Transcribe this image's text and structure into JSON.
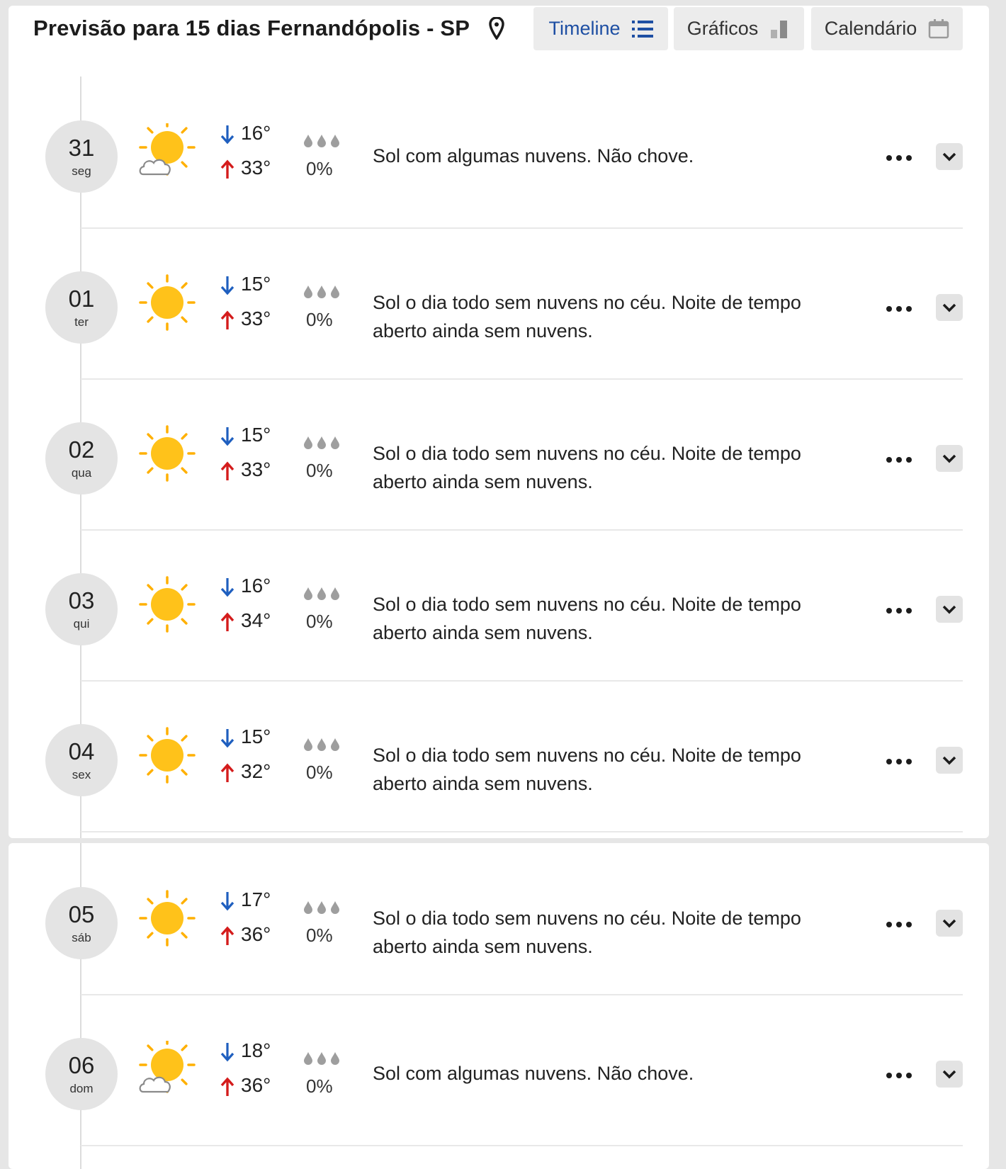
{
  "header": {
    "title": "Previsão para 15 dias Fernandópolis - SP",
    "tabs": [
      {
        "label": "Timeline",
        "icon": "list-icon",
        "active": true
      },
      {
        "label": "Gráficos",
        "icon": "bar-chart-icon",
        "active": false
      },
      {
        "label": "Calendário",
        "icon": "calendar-icon",
        "active": false
      }
    ]
  },
  "colors": {
    "accent": "#1e4fa3",
    "min_arrow": "#1f5fbf",
    "max_arrow": "#d41c1c",
    "sun": "#ffc21a",
    "circle_bg": "#e4e4e4"
  },
  "days": [
    {
      "day": "31",
      "weekday": "seg",
      "icon": "sun-cloud-icon",
      "min": "16°",
      "max": "33°",
      "rain": "0%",
      "description": "Sol com algumas nuvens. Não chove."
    },
    {
      "day": "01",
      "weekday": "ter",
      "icon": "sun-icon",
      "min": "15°",
      "max": "33°",
      "rain": "0%",
      "description": "Sol o dia todo sem nuvens no céu. Noite de tempo aberto ainda sem nuvens."
    },
    {
      "day": "02",
      "weekday": "qua",
      "icon": "sun-icon",
      "min": "15°",
      "max": "33°",
      "rain": "0%",
      "description": "Sol o dia todo sem nuvens no céu. Noite de tempo aberto ainda sem nuvens."
    },
    {
      "day": "03",
      "weekday": "qui",
      "icon": "sun-icon",
      "min": "16°",
      "max": "34°",
      "rain": "0%",
      "description": "Sol o dia todo sem nuvens no céu. Noite de tempo aberto ainda sem nuvens."
    },
    {
      "day": "04",
      "weekday": "sex",
      "icon": "sun-icon",
      "min": "15°",
      "max": "32°",
      "rain": "0%",
      "description": "Sol o dia todo sem nuvens no céu. Noite de tempo aberto ainda sem nuvens."
    },
    {
      "day": "05",
      "weekday": "sáb",
      "icon": "sun-icon",
      "min": "17°",
      "max": "36°",
      "rain": "0%",
      "description": "Sol o dia todo sem nuvens no céu. Noite de tempo aberto ainda sem nuvens."
    },
    {
      "day": "06",
      "weekday": "dom",
      "icon": "sun-cloud-icon",
      "min": "18°",
      "max": "36°",
      "rain": "0%",
      "description": "Sol com algumas nuvens. Não chove."
    }
  ]
}
